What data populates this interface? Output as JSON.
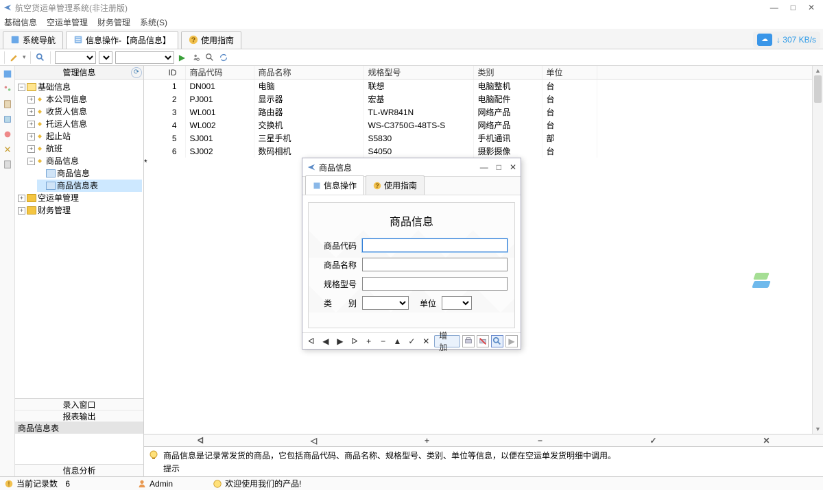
{
  "app_title": "航空货运单管理系统(非注册版)",
  "menu": [
    "基础信息",
    "空运单管理",
    "财务管理",
    "系统(S)"
  ],
  "tabs": [
    {
      "label": "系统导航"
    },
    {
      "label": "信息操作-【商品信息】"
    },
    {
      "label": "使用指南"
    }
  ],
  "speed": "307 KB/s",
  "sidebar": {
    "header": "管理信息",
    "tree": {
      "root": "基础信息",
      "children": [
        "本公司信息",
        "收货人信息",
        "托运人信息",
        "起止站",
        "航班"
      ],
      "product_node": "商品信息",
      "product_children": [
        "商品信息",
        "商品信息表"
      ],
      "other_roots": [
        "空运单管理",
        "财务管理"
      ]
    },
    "sections": [
      "录入窗口",
      "报表输出",
      "商品信息表"
    ],
    "analysis": "信息分析"
  },
  "grid": {
    "headers": [
      "ID",
      "商品代码",
      "商品名称",
      "规格型号",
      "类别",
      "单位"
    ],
    "rows": [
      [
        "1",
        "DN001",
        "电脑",
        "联想",
        "电脑整机",
        "台"
      ],
      [
        "2",
        "PJ001",
        "显示器",
        "宏基",
        "电脑配件",
        "台"
      ],
      [
        "3",
        "WL001",
        "路由器",
        "TL-WR841N",
        "网络产品",
        "台"
      ],
      [
        "4",
        "WL002",
        "交换机",
        "WS-C3750G-48TS-S",
        "网络产品",
        "台"
      ],
      [
        "5",
        "SJ001",
        "三星手机",
        "S5830",
        "手机通讯",
        "部"
      ],
      [
        "6",
        "SJ002",
        "数码相机",
        "S4050",
        "摄影摄像",
        "台"
      ]
    ]
  },
  "hint": {
    "line1": "商品信息是记录常发货的商品，它包括商品代码、商品名称、规格型号、类别、单位等信息，以便在空运单发货明细中调用。",
    "line2": "提示"
  },
  "status": {
    "records_label": "当前记录数",
    "records_value": "6",
    "user": "Admin",
    "welcome": "欢迎使用我们的产品!"
  },
  "dialog": {
    "title": "商品信息",
    "tabs": [
      "信息操作",
      "使用指南"
    ],
    "form_title": "商品信息",
    "labels": {
      "code": "商品代码",
      "name": "商品名称",
      "spec": "规格型号",
      "category": "类　　别",
      "unit": "单位"
    },
    "add_btn": "增加"
  }
}
